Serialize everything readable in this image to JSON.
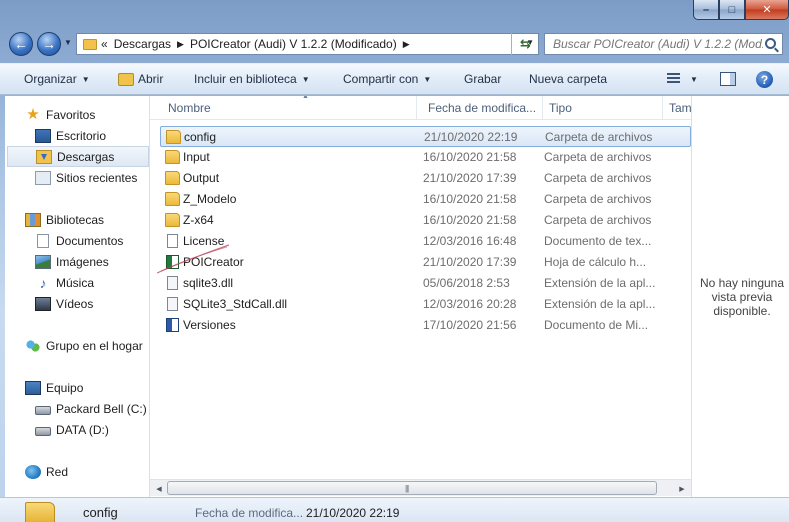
{
  "window": {
    "min": "–",
    "max": "□",
    "close": "✕"
  },
  "address": {
    "prefix": "«",
    "crumbs": [
      "Descargas",
      "POICreator (Audi) V 1.2.2 (Modificado)"
    ]
  },
  "search": {
    "placeholder": "Buscar POICreator (Audi) V 1.2.2 (Mod..."
  },
  "toolbar": {
    "organize": "Organizar",
    "open": "Abrir",
    "include": "Incluir en biblioteca",
    "share": "Compartir con",
    "burn": "Grabar",
    "new_folder": "Nueva carpeta",
    "help": "?"
  },
  "nav": {
    "favorites": "Favoritos",
    "desktop": "Escritorio",
    "downloads": "Descargas",
    "recent": "Sitios recientes",
    "libraries": "Bibliotecas",
    "documents": "Documentos",
    "images": "Imágenes",
    "music": "Música",
    "videos": "Vídeos",
    "homegroup": "Grupo en el hogar",
    "computer": "Equipo",
    "drive_c": "Packard Bell (C:)",
    "drive_d": "DATA (D:)",
    "network": "Red"
  },
  "columns": {
    "name": "Nombre",
    "date": "Fecha de modifica...",
    "type": "Tipo",
    "size": "Tam"
  },
  "files": [
    {
      "name": "config",
      "date": "21/10/2020 22:19",
      "type": "Carpeta de archivos"
    },
    {
      "name": "Input",
      "date": "16/10/2020 21:58",
      "type": "Carpeta de archivos"
    },
    {
      "name": "Output",
      "date": "21/10/2020 17:39",
      "type": "Carpeta de archivos"
    },
    {
      "name": "Z_Modelo",
      "date": "16/10/2020 21:58",
      "type": "Carpeta de archivos"
    },
    {
      "name": "Z-x64",
      "date": "16/10/2020 21:58",
      "type": "Carpeta de archivos"
    },
    {
      "name": "License",
      "date": "12/03/2016 16:48",
      "type": "Documento de tex..."
    },
    {
      "name": "POICreator",
      "date": "21/10/2020 17:39",
      "type": "Hoja de cálculo h..."
    },
    {
      "name": "sqlite3.dll",
      "date": "05/06/2018 2:53",
      "type": "Extensión de la apl..."
    },
    {
      "name": "SQLite3_StdCall.dll",
      "date": "12/03/2016 20:28",
      "type": "Extensión de la apl..."
    },
    {
      "name": "Versiones",
      "date": "17/10/2020 21:56",
      "type": "Documento de Mi..."
    }
  ],
  "preview": {
    "text": "No hay ninguna vista previa disponible."
  },
  "details": {
    "name": "config",
    "date_label": "Fecha de modifica...",
    "date_value": "21/10/2020 22:19"
  }
}
